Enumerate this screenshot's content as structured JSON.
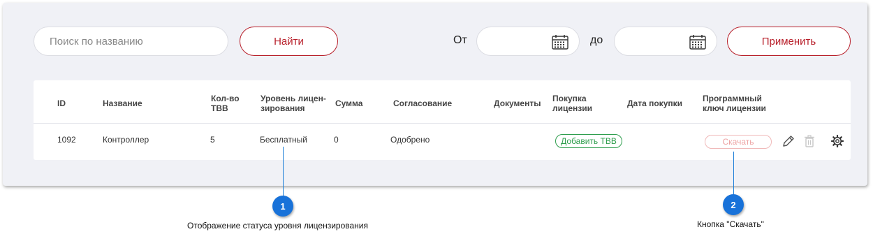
{
  "search": {
    "placeholder": "Поиск по названию",
    "find_label": "Найти"
  },
  "filter": {
    "from_label": "От",
    "to_label": "до",
    "apply_label": "Применить"
  },
  "table": {
    "headers": {
      "id": "ID",
      "name": "Название",
      "qty": "Кол-во\nТВВ",
      "level": "Уровень лицен-\nзирования",
      "sum": "Сумма",
      "approval": "Согласование",
      "docs": "Документы",
      "purchase": "Покупка\nлицензии",
      "purchase_date": "Дата покупки",
      "key": "Программный\nключ лицензии"
    },
    "rows": [
      {
        "id": "1092",
        "name": "Контроллер",
        "qty": "5",
        "level": "Бесплатный",
        "sum": "0",
        "approval": "Одобрено",
        "docs": "",
        "add_label": "Добавить ТВВ",
        "purchase_date": "",
        "download_label": "Скачать"
      }
    ]
  },
  "callouts": [
    {
      "number": "1",
      "text": "Отображение статуса уровня лицензирования"
    },
    {
      "number": "2",
      "text": "Кнопка \"Скачать\""
    }
  ],
  "colors": {
    "accent_red": "#b8202b",
    "success_green": "#2e9e4d",
    "disabled_pink": "#eda3a3",
    "callout_blue": "#1872d9",
    "panel_bg": "#f0f1f6"
  },
  "icons": {
    "date_from": "calendar-icon",
    "date_to": "calendar-icon",
    "row_actions": [
      "pencil-icon",
      "trash-icon",
      "gear-icon"
    ]
  }
}
